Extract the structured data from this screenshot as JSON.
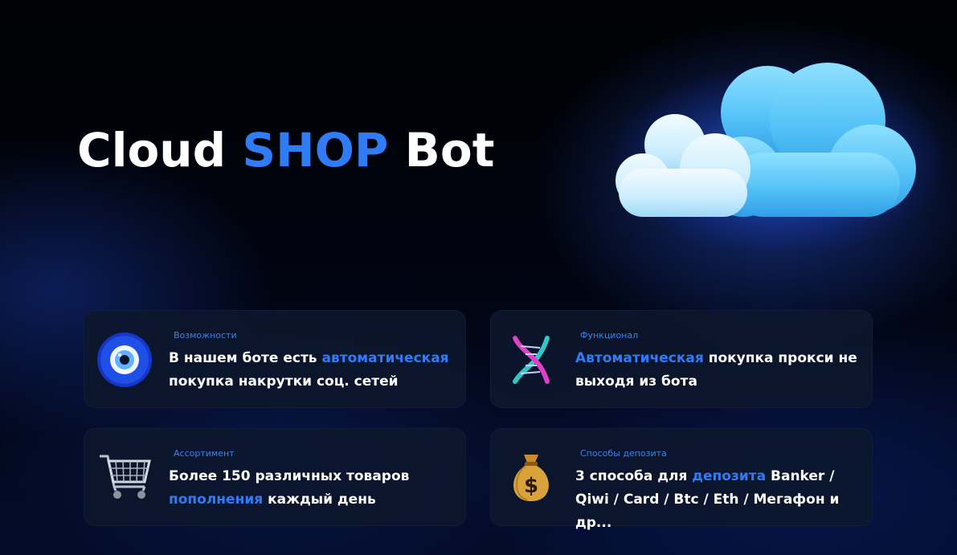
{
  "header": {
    "title_part1": "Cloud",
    "title_part2": "SHOP",
    "title_part3": "Bot"
  },
  "colors": {
    "accent": "#2f7cf6",
    "background": "#01040f",
    "card": "#0d172c",
    "text": "#ffffff"
  },
  "cards": [
    {
      "icon": "evil-eye-icon",
      "label": "Возможности",
      "line1_pre": "В нашем боте есть ",
      "line1_hl": "автоматическая",
      "line2": "покупка накрутки соц. сетей"
    },
    {
      "icon": "dna-icon",
      "label": "Функционал",
      "line1_hl": "Автоматическая",
      "line1_post": " покупка прокси не",
      "line2": "выходя из бота"
    },
    {
      "icon": "shopping-cart-icon",
      "label": "Ассортимент",
      "line1": "Более 150 различных товаров",
      "line2_hl": "пополнения",
      "line2_post": " каждый день"
    },
    {
      "icon": "money-bag-icon",
      "label": "Способы депозита",
      "line1_pre": "3 способа для ",
      "line1_hl": "депозита",
      "line1_post": " Banker /",
      "line2": "Qiwi / Card / Btc / Eth / Мегафон и др..."
    }
  ]
}
